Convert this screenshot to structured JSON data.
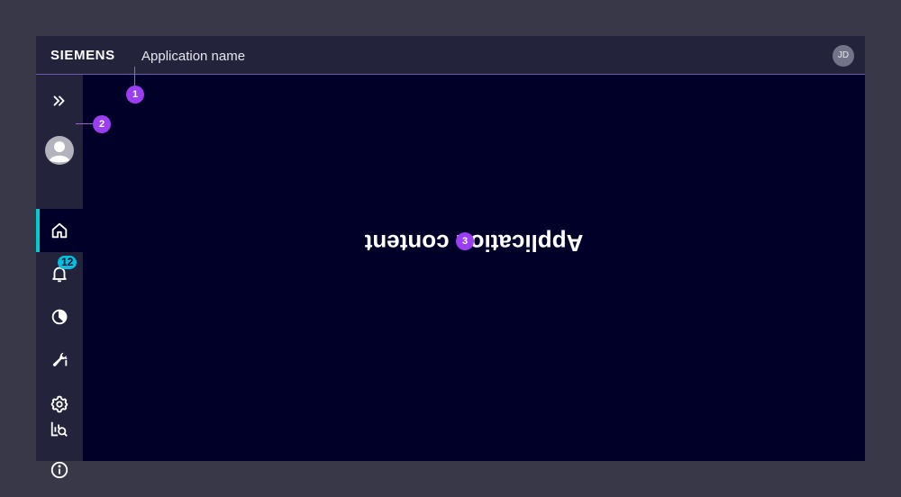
{
  "header": {
    "brand": "SIEMENS",
    "app_name": "Application name",
    "user_initials": "JD"
  },
  "sidebar": {
    "items": [
      {
        "icon": "double-chevron-right-icon"
      },
      {
        "icon": "user-avatar-icon"
      },
      {
        "icon": "home-icon",
        "active": true
      },
      {
        "icon": "bell-icon",
        "badge": "12"
      },
      {
        "icon": "pie-chart-icon"
      },
      {
        "icon": "wrench-info-icon"
      },
      {
        "icon": "gear-icon"
      },
      {
        "icon": "chart-search-icon"
      },
      {
        "icon": "info-icon"
      }
    ]
  },
  "content": {
    "text": "Application content"
  },
  "annotations": [
    "1",
    "2",
    "3"
  ],
  "colors": {
    "background": "#383849",
    "header": "#23233c",
    "content": "#000028",
    "active_indicator": "#00cccc",
    "badge": "#00bedc",
    "marker": "#9b3df0"
  }
}
